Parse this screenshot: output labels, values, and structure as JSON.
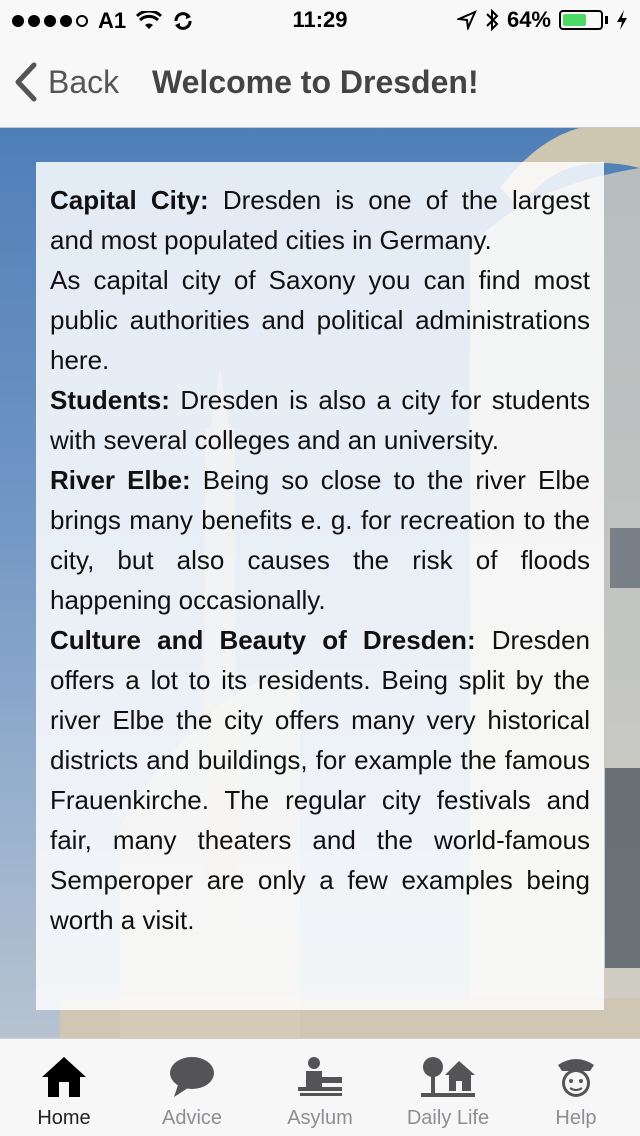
{
  "status_bar": {
    "carrier": "A1",
    "time": "11:29",
    "battery_percent": "64%",
    "battery_level": 0.64,
    "icons": [
      "wifi-icon",
      "sync-icon",
      "location-icon",
      "bluetooth-icon",
      "battery-icon",
      "charging-icon"
    ]
  },
  "nav": {
    "back_label": "Back",
    "title": "Welcome to Dresden!"
  },
  "content": {
    "sections": [
      {
        "heading": "Capital City:",
        "text": " Dresden is one of the largest and most populated cities in Germany."
      },
      {
        "heading": "",
        "text": "As capital city of Saxony you can find most public authorities and political administrations here."
      },
      {
        "heading": "Students:",
        "text": " Dresden is also a city for students with several colleges and an university."
      },
      {
        "heading": "River Elbe:",
        "text": " Being so close to the river Elbe brings many benefits e. g. for recreation to the city, but also causes the risk of floods happening occasionally."
      },
      {
        "heading": "Culture and Beauty of Dresden:",
        "text": " Dresden offers a lot to its residents. Being split by the river Elbe the city offers many very historical districts and buildings, for example the famous Frauenkirche. The regular city festivals and fair, many theaters and the world-famous Semperoper are only a few examples being worth a visit."
      }
    ]
  },
  "tabs": [
    {
      "label": "Home",
      "icon": "home-icon",
      "active": true
    },
    {
      "label": "Advice",
      "icon": "speech-bubble-icon",
      "active": false
    },
    {
      "label": "Asylum",
      "icon": "desk-person-icon",
      "active": false
    },
    {
      "label": "Daily Life",
      "icon": "tree-house-icon",
      "active": false
    },
    {
      "label": "Help",
      "icon": "police-officer-icon",
      "active": false
    }
  ],
  "colors": {
    "active_tab": "#222222",
    "inactive_tab": "#8e8e93",
    "battery": "#4cd964"
  }
}
